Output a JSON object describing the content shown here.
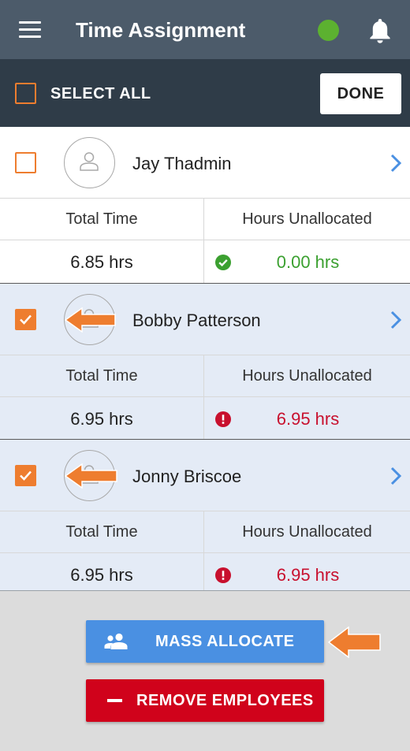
{
  "header": {
    "title": "Time Assignment",
    "menu_icon": "hamburger-menu-icon",
    "status_color": "#5cb130",
    "notification_icon": "bell-icon"
  },
  "selection_bar": {
    "select_all_label": "SELECT ALL",
    "select_all_checked": false,
    "done_label": "DONE"
  },
  "columns": {
    "total_time": "Total Time",
    "hours_unallocated": "Hours Unallocated"
  },
  "employees": [
    {
      "name": "Jay Thadmin",
      "checked": false,
      "total_time": "6.85 hrs",
      "hours_unallocated": "0.00 hrs",
      "status": "ok"
    },
    {
      "name": "Bobby Patterson",
      "checked": true,
      "total_time": "6.95 hrs",
      "hours_unallocated": "6.95 hrs",
      "status": "warning"
    },
    {
      "name": "Jonny Briscoe",
      "checked": true,
      "total_time": "6.95 hrs",
      "hours_unallocated": "6.95 hrs",
      "status": "warning"
    }
  ],
  "actions": {
    "mass_allocate_label": "MASS ALLOCATE",
    "remove_employees_label": "REMOVE EMPLOYEES"
  },
  "colors": {
    "accent_orange": "#ee7d2f",
    "primary_blue": "#4a90e2",
    "danger_red": "#d0021b",
    "ok_green": "#3ba030"
  }
}
